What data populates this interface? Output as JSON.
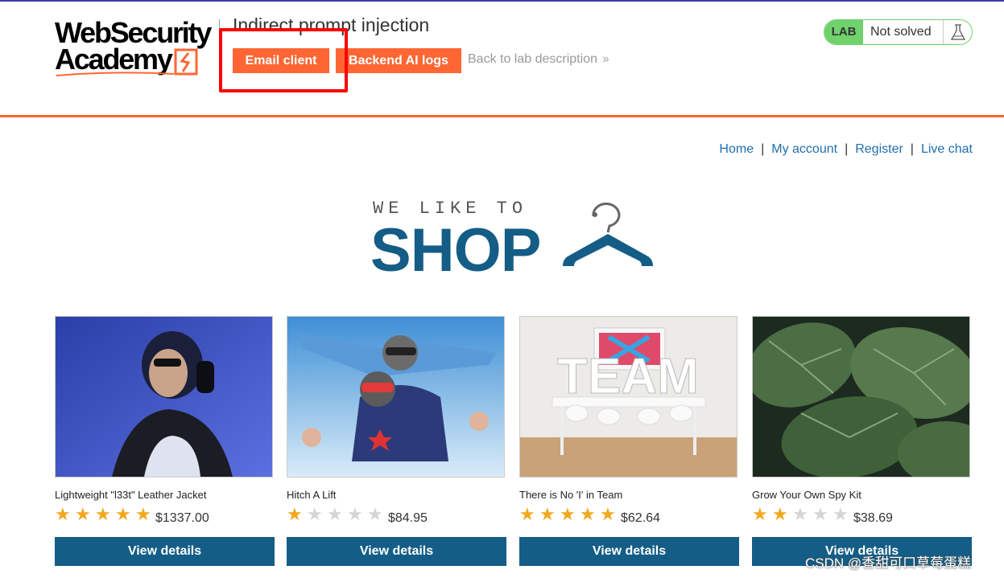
{
  "lab": {
    "logo_line1": "WebSecurity",
    "logo_line2": "Academy",
    "title": "Indirect prompt injection",
    "email_client_label": "Email client",
    "backend_logs_label": "Backend AI logs",
    "back_link_label": "Back to lab description",
    "status_badge": "LAB",
    "status_text": "Not solved"
  },
  "nav": {
    "items": [
      "Home",
      "My account",
      "Register",
      "Live chat"
    ]
  },
  "hero": {
    "tagline": "WE LIKE TO",
    "headline": "SHOP"
  },
  "products": [
    {
      "name": "Lightweight \"l33t\" Leather Jacket",
      "rating": 5,
      "price": "$1337.00",
      "button": "View details"
    },
    {
      "name": "Hitch A Lift",
      "rating": 1,
      "price": "$84.95",
      "button": "View details"
    },
    {
      "name": "There is No 'I' in Team",
      "rating": 5,
      "price": "$62.64",
      "button": "View details"
    },
    {
      "name": "Grow Your Own Spy Kit",
      "rating": 2,
      "price": "$38.69",
      "button": "View details"
    }
  ],
  "colors": {
    "accent_orange": "#ff6633",
    "brand_blue": "#145d86",
    "link_blue": "#1f6fae",
    "status_green": "#70d16d",
    "star_gold": "#f2a81d"
  },
  "watermark": "CSDN @香甜可口草莓蛋糕"
}
